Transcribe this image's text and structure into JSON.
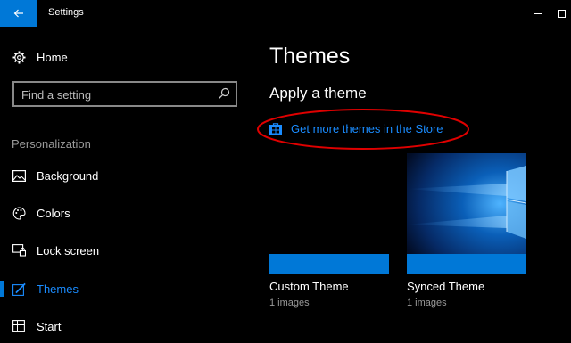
{
  "window": {
    "title": "Settings"
  },
  "sidebar": {
    "home_label": "Home",
    "search_placeholder": "Find a setting",
    "section_header": "Personalization",
    "items": [
      {
        "label": "Background",
        "icon": "picture-icon"
      },
      {
        "label": "Colors",
        "icon": "palette-icon"
      },
      {
        "label": "Lock screen",
        "icon": "lock-screen-icon"
      },
      {
        "label": "Themes",
        "icon": "themes-icon",
        "active": true
      },
      {
        "label": "Start",
        "icon": "start-icon"
      }
    ]
  },
  "main": {
    "title": "Themes",
    "subheading": "Apply a theme",
    "store_link": "Get more themes in the Store",
    "themes": [
      {
        "name": "Custom Theme",
        "count": "1 images"
      },
      {
        "name": "Synced Theme",
        "count": "1 images"
      }
    ]
  },
  "colors": {
    "accent": "#0078d7",
    "link": "#1a8cff",
    "background": "#000000",
    "annotation": "#e00000"
  }
}
